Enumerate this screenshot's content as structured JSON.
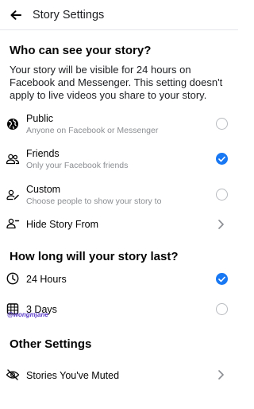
{
  "header": {
    "title": "Story Settings",
    "back_icon": "back-arrow-icon"
  },
  "audience": {
    "title": "Who can see your story?",
    "description": "Your story will be visible for 24 hours on Facebook and Messenger. This setting doesn't apply to live videos you share to your story.",
    "options": [
      {
        "label": "Public",
        "sublabel": "Anyone on Facebook or Messenger",
        "icon": "globe-icon",
        "selected": false
      },
      {
        "label": "Friends",
        "sublabel": "Only your Facebook friends",
        "icon": "friends-icon",
        "selected": true
      },
      {
        "label": "Custom",
        "sublabel": "Choose people to show your story to",
        "icon": "custom-people-icon",
        "selected": false
      }
    ],
    "hide_story": {
      "label": "Hide Story From",
      "icon": "hide-person-icon"
    }
  },
  "duration": {
    "title": "How long will your story last?",
    "options": [
      {
        "label": "24 Hours",
        "icon": "clock-icon",
        "selected": true
      },
      {
        "label": "3 Days",
        "icon": "calendar-icon",
        "selected": false
      }
    ]
  },
  "watermark": "@wongmjane",
  "other": {
    "title": "Other Settings",
    "muted": {
      "label": "Stories You've Muted",
      "icon": "muted-eye-icon"
    }
  },
  "colors": {
    "accent": "#1877f2",
    "secondary_text": "#8a8d91",
    "divider": "#e4e6eb"
  }
}
